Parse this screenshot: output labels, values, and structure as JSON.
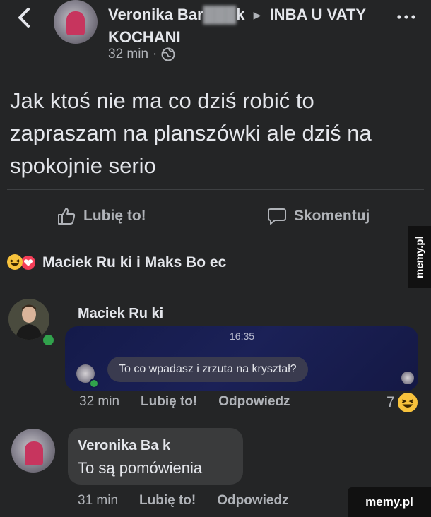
{
  "header": {
    "author": "Veronika Bar",
    "author_obscured_suffix": "k",
    "group": "INBA U VATY KOCHANI",
    "time": "32 min",
    "dot": "·",
    "back_icon": "chevron-left-icon",
    "privacy_icon": "globe-icon",
    "more_icon": "more-horizontal-icon"
  },
  "post": {
    "text": "Jak ktoś nie ma co dziś robić to zapraszam na planszówki ale dziś na spokojnie serio"
  },
  "actions": {
    "like": "Lubię to!",
    "comment": "Skomentuj"
  },
  "reactions": {
    "text": "Maciek Ru ki i Maks Bo ec",
    "emojis": [
      "laugh",
      "love"
    ]
  },
  "comments": [
    {
      "author": "Maciek Ru ki",
      "message_time": "16:35",
      "message_text": "To co wpadasz i zrzuta na kryształ?",
      "time": "32 min",
      "like": "Lubię to!",
      "reply": "Odpowiedz",
      "reaction_count": "7"
    },
    {
      "author": "Veronika Ba k",
      "text": "To są pomówienia",
      "time": "31 min",
      "like": "Lubię to!",
      "reply": "Odpowiedz"
    }
  ],
  "watermarks": {
    "side": "memy.pl",
    "footer": "memy.pl"
  },
  "colors": {
    "background": "#242526",
    "primary_text": "#e4e6eb",
    "secondary_text": "#b0b3b8",
    "online": "#31a24c",
    "message_bg": "#1b2157"
  }
}
